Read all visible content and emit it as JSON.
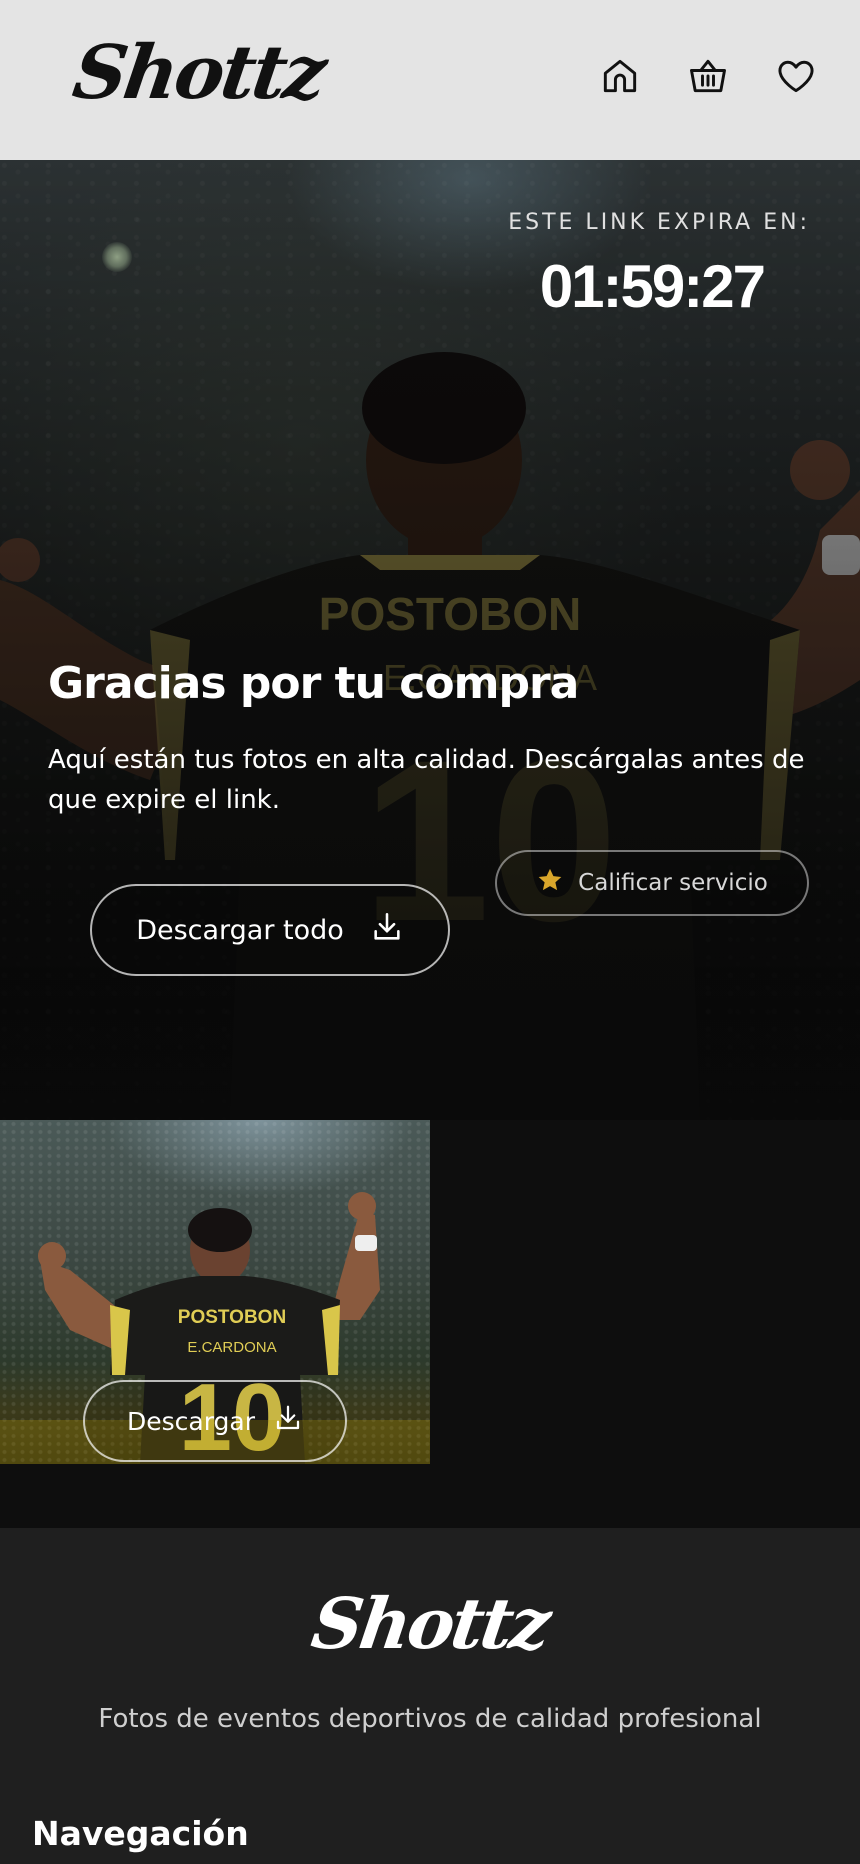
{
  "header": {
    "logo": "Shottz",
    "icons": [
      "home-icon",
      "basket-icon",
      "heart-icon"
    ]
  },
  "hero": {
    "expire_label": "ESTE LINK EXPIRA EN:",
    "expire_time": "01:59:27",
    "title": "Gracias por tu compra",
    "subtitle": "Aquí están tus fotos en alta calidad. Descárgalas antes de que expire el link.",
    "rate_button": "Calificar servicio",
    "download_all_button": "Descargar todo"
  },
  "gallery": {
    "photos": [
      {
        "download_label": "Descargar"
      }
    ]
  },
  "footer": {
    "logo": "Shottz",
    "tagline": "Fotos de eventos deportivos de calidad profesional",
    "nav_heading": "Navegación"
  },
  "colors": {
    "header_bg": "#e4e4e4",
    "page_bg": "#0e0e0e",
    "footer_bg": "#1f1f1f",
    "star": "#d9a62b",
    "jersey_accent": "#c9b85a"
  }
}
